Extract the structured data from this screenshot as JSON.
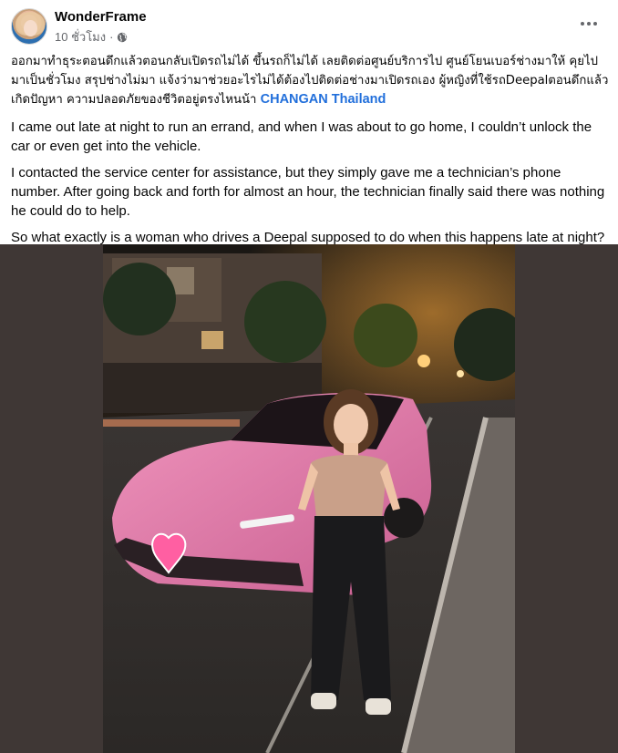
{
  "post": {
    "author": "WonderFrame",
    "time": "10 ชั่วโมง",
    "separator": "·",
    "privacy_icon": "globe-icon",
    "more_icon": "more-options-icon",
    "thai_text": "ออกมาทำธุระตอนดึกแล้วตอนกลับเปิดรถไม่ได้ ขึ้นรถก็ไม่ได้ เลยติดต่อศูนย์บริการไป ศูนย์โยนเบอร์ช่างมาให้ คุยไปมาเป็นชั่วโมง สรุปช่างไม่มา แจ้งว่ามาช่วยอะไรไม่ได้ต้องไปติดต่อช่างมาเปิดรถเอง ผู้หญิงที่ใช้รถDeepalตอนดึกแล้วเกิดปัญหา ความปลอดภัยของชีวิตอยู่ตรงไหนน้า",
    "mention": "CHANGAN Thailand",
    "en_paragraphs": [
      "I came out late at night to run an errand, and when I was about to go home, I couldn’t unlock the car or even get into the vehicle.",
      "I contacted the service center for assistance, but they simply gave me a technician’s phone number. After going back and forth for almost an hour, the technician finally said there was nothing he could do to help.",
      "So what exactly is a woman who drives a Deepal supposed to do when this happens late at night?"
    ],
    "colors": {
      "link": "#216fdb",
      "secondary_text": "#65676b",
      "car_pink": "#e27aa8",
      "photo_border": "#3f3735"
    }
  }
}
